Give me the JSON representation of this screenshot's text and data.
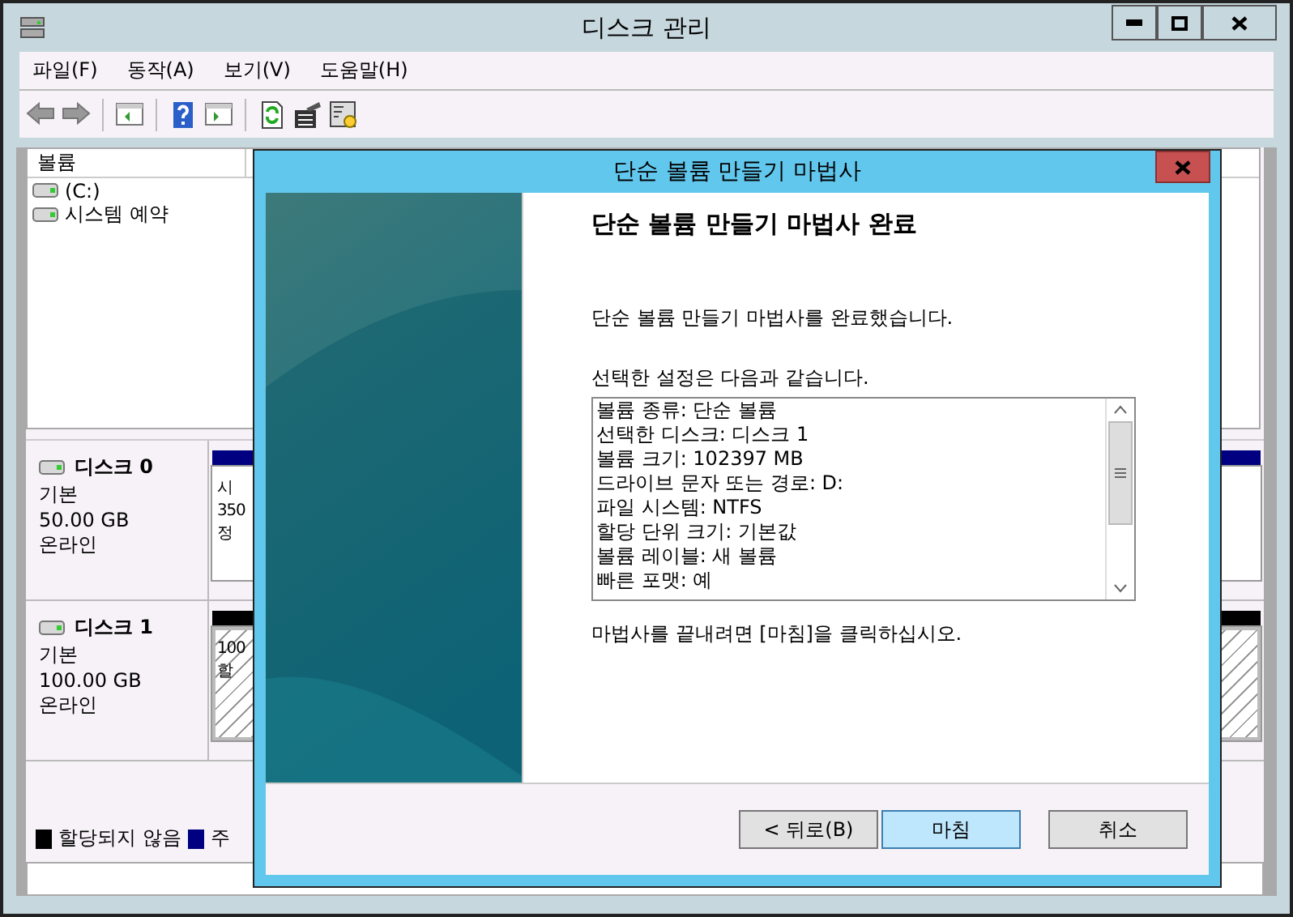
{
  "window": {
    "title": "디스크 관리"
  },
  "menu": [
    "파일(F)",
    "동작(A)",
    "보기(V)",
    "도움말(H)"
  ],
  "volume_list": {
    "columns": [
      "볼륨"
    ],
    "rows": [
      "(C:)",
      "시스템 예약"
    ]
  },
  "disks": [
    {
      "name": "디스크 0",
      "type": "기본",
      "size": "50.00 GB",
      "status": "온라인",
      "partition": {
        "kind": "primary",
        "lines": [
          "시",
          "350",
          "정"
        ]
      }
    },
    {
      "name": "디스크 1",
      "type": "기본",
      "size": "100.00 GB",
      "status": "온라인",
      "partition": {
        "kind": "unallocated",
        "lines": [
          "100",
          "할"
        ]
      }
    }
  ],
  "legend": [
    {
      "label": "할당되지 않음",
      "color": "#000000"
    },
    {
      "label": "주",
      "color": "#000080"
    }
  ],
  "wizard": {
    "title": "단순 볼륨 만들기 마법사",
    "heading": "단순 볼륨 만들기 마법사 완료",
    "message": "단순 볼륨 만들기 마법사를 완료했습니다.",
    "settings_label": "선택한 설정은 다음과 같습니다.",
    "settings": [
      "볼륨 종류: 단순 볼륨",
      "선택한 디스크: 디스크 1",
      "볼륨 크기: 102397 MB",
      "드라이브 문자 또는 경로: D:",
      "파일 시스템: NTFS",
      "할당 단위 크기: 기본값",
      "볼륨 레이블: 새 볼륨",
      "빠른 포맷: 예"
    ],
    "footer_note": "마법사를 끝내려면 [마침]을 클릭하십시오.",
    "buttons": [
      {
        "label": "< 뒤로(B)",
        "selected": false
      },
      {
        "label": "마침",
        "selected": true
      },
      {
        "label": "취소",
        "selected": false
      }
    ]
  }
}
